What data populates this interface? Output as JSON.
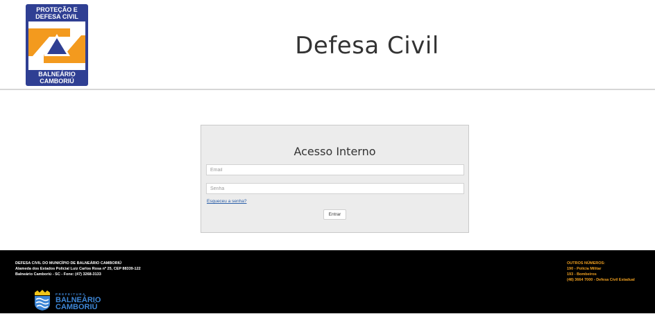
{
  "header": {
    "logo_top": "PROTEÇÃO E\nDEFESA CIVIL",
    "logo_bottom": "BALNEÁRIO\nCAMBORIÚ",
    "title": "Defesa Civil"
  },
  "login": {
    "title": "Acesso Interno",
    "email_placeholder": "Email",
    "password_placeholder": "Senha",
    "forgot_label": "Esqueceu a senha?",
    "submit_label": "Entrar"
  },
  "footer": {
    "line1": "DEFESA CIVIL DO MUNICÍPIO DE BALNEÁRIO CAMBORIÚ",
    "line2": "Alameda dos Estados Policial Luiz Carlos Rosa nº 25, CEP 88339-122",
    "line3": "Balneário Camboriú - SC - Fone: (47) 3268-3133",
    "prefeitura_small": "PREFEITURA",
    "prefeitura_name1": "BALNEÁRIO",
    "prefeitura_name2": "CAMBORIÚ",
    "other_title": "OUTROS NÚMEROS:",
    "other1": "190 - Polícia Militar",
    "other2": "193 - Bombeiros",
    "other3": "(48) 3664 7000 - Defesa Civil Estadual"
  },
  "colors": {
    "logo_blue": "#2f3f93",
    "logo_orange": "#f39a1e",
    "footer_bg": "#000000",
    "footer_accent": "#f0a020",
    "link": "#2a5ea8"
  },
  "icons": {
    "logo": "civil-defense-triangle-icon",
    "prefeitura": "city-crest-icon"
  }
}
